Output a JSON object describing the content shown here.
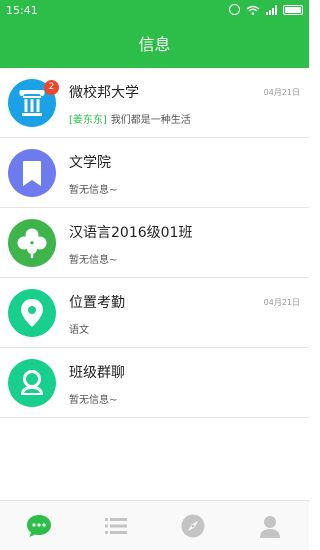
{
  "status_bar": {
    "time": "15:41",
    "icons": [
      "alarm-icon",
      "wifi-icon",
      "signal-icon",
      "battery-icon"
    ]
  },
  "header": {
    "title": "信息"
  },
  "messages": [
    {
      "name": "微校邦大学",
      "badge": "2",
      "highlight": "[姜东东]",
      "preview": "我们都是一种生活",
      "date": "04月21日",
      "icon": "pillar-icon",
      "color": "#1aa1e6"
    },
    {
      "name": "文学院",
      "badge": "",
      "highlight": "",
      "preview": "暂无信息~",
      "date": "",
      "icon": "bookmark-icon",
      "color": "#6e7bef"
    },
    {
      "name": "汉语言2016级01班",
      "badge": "",
      "highlight": "",
      "preview": "暂无信息~",
      "date": "",
      "icon": "clover-icon",
      "color": "#3db54a"
    },
    {
      "name": "位置考勤",
      "badge": "",
      "highlight": "",
      "preview": "语文",
      "date": "04月21日",
      "icon": "location-pin-icon",
      "color": "#19cf8e"
    },
    {
      "name": "班级群聊",
      "badge": "",
      "highlight": "",
      "preview": "暂无信息~",
      "date": "",
      "icon": "group-chat-icon",
      "color": "#19cf8e"
    }
  ],
  "tabbar": {
    "items": [
      "chat-bubble-icon",
      "list-icon",
      "compass-icon",
      "profile-icon"
    ],
    "active_color": "#2dbe4a",
    "inactive_color": "#c4c4c4"
  }
}
